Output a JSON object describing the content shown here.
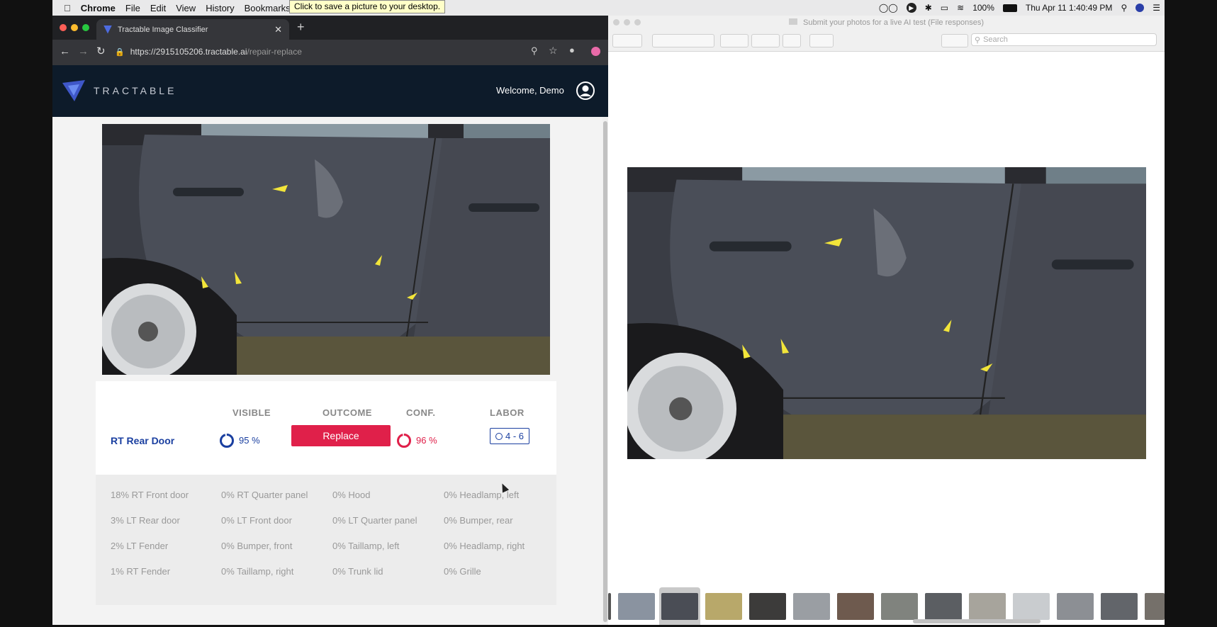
{
  "menubar": {
    "app": "Chrome",
    "items": [
      "File",
      "Edit",
      "View",
      "History",
      "Bookmarks"
    ],
    "tooltip": "Click to save a picture to your desktop.",
    "battery": "100%",
    "clock": "Thu Apr 11  1:40:49 PM"
  },
  "browser": {
    "tab_title": "Tractable Image Classifier",
    "url_host": "https://2915105206.tractable.ai",
    "url_path": "/repair-replace"
  },
  "app": {
    "brand": "TRACTABLE",
    "welcome": "Welcome, Demo",
    "colors": {
      "header": "#0d1b2a",
      "accent": "#1a3fa0",
      "replace": "#e0204a"
    }
  },
  "result": {
    "headers": {
      "visible": "VISIBLE",
      "outcome": "OUTCOME",
      "conf": "CONF.",
      "labor": "LABOR"
    },
    "part": "RT Rear Door",
    "visible": "95 %",
    "visible_fraction": 0.95,
    "outcome": "Replace",
    "conf": "96 %",
    "conf_fraction": 0.96,
    "labor": "4 - 6"
  },
  "other_parts": [
    [
      "18% RT Front door",
      "0% RT Quarter panel",
      "0% Hood",
      "0% Headlamp, left"
    ],
    [
      "3% LT Rear door",
      "0% LT Front door",
      "0% LT Quarter panel",
      "0% Bumper, rear"
    ],
    [
      "2% LT Fender",
      "0% Bumper, front",
      "0% Taillamp, left",
      "0% Headlamp, right"
    ],
    [
      "1% RT Fender",
      "0% Taillamp, right",
      "0% Trunk lid",
      "0% Grille"
    ]
  ],
  "finder": {
    "title": "Submit your photos for a live AI test (File responses)",
    "search_placeholder": "Search"
  }
}
